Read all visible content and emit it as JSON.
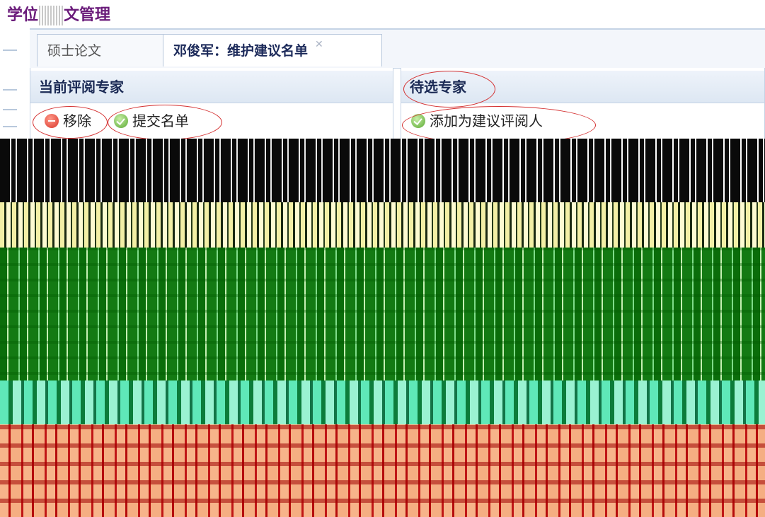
{
  "app": {
    "title_part1": "学位",
    "title_part2": "文管理"
  },
  "tabs": [
    {
      "label": "硕士论文"
    },
    {
      "label": "邓俊军：维护建议名单"
    }
  ],
  "left_panel": {
    "title": "当前评阅专家",
    "remove_button": "移除",
    "submit_button": "提交名单"
  },
  "right_panel": {
    "title": "待选专家",
    "add_button": "添加为建议评阅人"
  },
  "colors": {
    "title_purple": "#6a1b7a",
    "annotation_red": "#d43030",
    "accent_blue": "#1b2a55"
  }
}
